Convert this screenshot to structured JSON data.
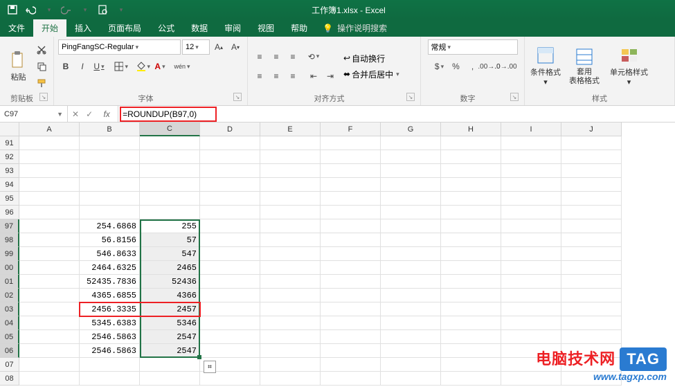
{
  "app": {
    "title": "工作簿1.xlsx - Excel"
  },
  "menu": {
    "file": "文件",
    "home": "开始",
    "insert": "插入",
    "layout": "页面布局",
    "formulas": "公式",
    "data": "数据",
    "review": "审阅",
    "view": "视图",
    "help": "帮助",
    "tellme": "操作说明搜索"
  },
  "ribbon": {
    "clipboard": {
      "paste": "粘贴",
      "label": "剪贴板"
    },
    "font": {
      "name": "PingFangSC-Regular",
      "size": "12",
      "label": "字体",
      "pinyin": "wén"
    },
    "align": {
      "wrap": "自动换行",
      "merge": "合并后居中",
      "label": "对齐方式"
    },
    "number": {
      "format": "常规",
      "label": "数字"
    },
    "styles": {
      "cond": "条件格式",
      "table": "套用\n表格格式",
      "cell": "单元格样式",
      "label": "样式"
    }
  },
  "namebox": "C97",
  "formula": "=ROUNDUP(B97,0)",
  "columns": [
    "A",
    "B",
    "C",
    "D",
    "E",
    "F",
    "G",
    "H",
    "I",
    "J"
  ],
  "rows": [
    "91",
    "92",
    "93",
    "94",
    "95",
    "96",
    "97",
    "98",
    "99",
    "00",
    "01",
    "02",
    "03",
    "04",
    "05",
    "06",
    "07",
    "08"
  ],
  "data_start_row_index": 6,
  "col_b": [
    "254.6868",
    "56.8156",
    "546.8633",
    "2464.6325",
    "52435.7836",
    "4365.6855",
    "2456.3335",
    "5345.6383",
    "2546.5863",
    "2546.5863"
  ],
  "col_c": [
    "255",
    "57",
    "547",
    "2465",
    "52436",
    "4366",
    "2457",
    "5346",
    "2547",
    "2547"
  ],
  "autofill_icon": "⌗",
  "watermark": {
    "line1": "电脑技术网",
    "tag": "TAG",
    "line2": "www.tagxp.com"
  }
}
